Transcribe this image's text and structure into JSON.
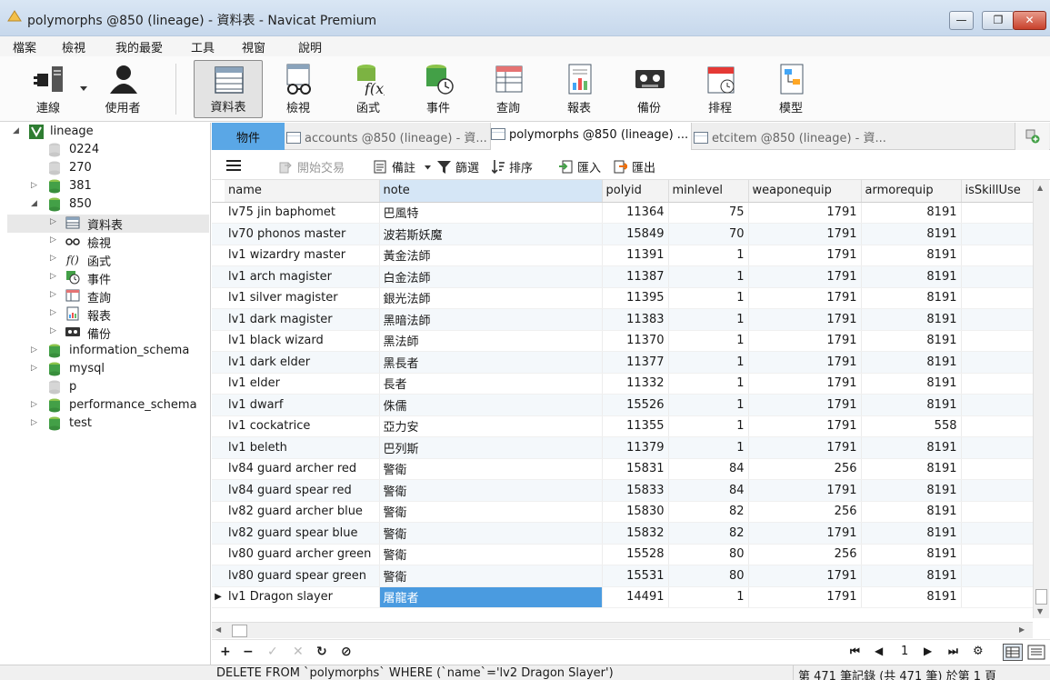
{
  "window": {
    "title": "polymorphs @850 (lineage) - 資料表 - Navicat Premium",
    "min": "—",
    "max": "❐",
    "close": "✕"
  },
  "menu": [
    "檔案",
    "檢視",
    "我的最愛",
    "工具",
    "視窗",
    "說明"
  ],
  "toolbar": {
    "connection": "連線",
    "user": "使用者",
    "table": "資料表",
    "view": "檢視",
    "function": "函式",
    "event": "事件",
    "query": "查詢",
    "report": "報表",
    "backup": "備份",
    "schedule": "排程",
    "model": "模型"
  },
  "tree": {
    "root": "lineage",
    "db_0224": "0224",
    "db_270": "270",
    "db_381": "381",
    "db_850": "850",
    "child_table": "資料表",
    "child_view": "檢視",
    "child_function": "函式",
    "child_event": "事件",
    "child_query": "查詢",
    "child_report": "報表",
    "child_backup": "備份",
    "db_information_schema": "information_schema",
    "db_mysql": "mysql",
    "db_p": "p",
    "db_performance_schema": "performance_schema",
    "db_test": "test"
  },
  "tabs": {
    "objects": "物件",
    "accounts": "accounts @850 (lineage) - 資...",
    "polymorphs": "polymorphs @850 (lineage) ...",
    "etcitem": "etcitem @850 (lineage) - 資..."
  },
  "subtoolbar": {
    "begin_transaction": "開始交易",
    "memo": "備註",
    "filter": "篩選",
    "sort": "排序",
    "import": "匯入",
    "export": "匯出"
  },
  "columns": [
    "name",
    "note",
    "polyid",
    "minlevel",
    "weaponequip",
    "armorequip",
    "isSkillUse"
  ],
  "rows": [
    [
      "lv75 jin baphomet",
      "巴風特",
      "11364",
      "75",
      "1791",
      "8191",
      ""
    ],
    [
      "lv70 phonos master",
      "波若斯妖魔",
      "15849",
      "70",
      "1791",
      "8191",
      ""
    ],
    [
      "lv1 wizardry master",
      "黃金法師",
      "11391",
      "1",
      "1791",
      "8191",
      ""
    ],
    [
      "lv1 arch magister",
      "白金法師",
      "11387",
      "1",
      "1791",
      "8191",
      ""
    ],
    [
      "lv1 silver magister",
      "銀光法師",
      "11395",
      "1",
      "1791",
      "8191",
      ""
    ],
    [
      "lv1 dark magister",
      "黑暗法師",
      "11383",
      "1",
      "1791",
      "8191",
      ""
    ],
    [
      "lv1 black wizard",
      "黑法師",
      "11370",
      "1",
      "1791",
      "8191",
      ""
    ],
    [
      "lv1 dark elder",
      "黑長者",
      "11377",
      "1",
      "1791",
      "8191",
      ""
    ],
    [
      "lv1 elder",
      "長者",
      "11332",
      "1",
      "1791",
      "8191",
      ""
    ],
    [
      "lv1 dwarf",
      "侏儒",
      "15526",
      "1",
      "1791",
      "8191",
      ""
    ],
    [
      "lv1 cockatrice",
      "亞力安",
      "11355",
      "1",
      "1791",
      "558",
      ""
    ],
    [
      "lv1 beleth",
      "巴列斯",
      "11379",
      "1",
      "1791",
      "8191",
      ""
    ],
    [
      "lv84 guard archer red",
      "警衛",
      "15831",
      "84",
      "256",
      "8191",
      ""
    ],
    [
      "lv84 guard spear red",
      "警衛",
      "15833",
      "84",
      "1791",
      "8191",
      ""
    ],
    [
      "lv82 guard archer blue",
      "警衛",
      "15830",
      "82",
      "256",
      "8191",
      ""
    ],
    [
      "lv82 guard spear blue",
      "警衛",
      "15832",
      "82",
      "1791",
      "8191",
      ""
    ],
    [
      "lv80 guard archer green",
      "警衛",
      "15528",
      "80",
      "256",
      "8191",
      ""
    ],
    [
      "lv80 guard spear green",
      "警衛",
      "15531",
      "80",
      "1791",
      "8191",
      ""
    ],
    [
      "lv1 Dragon slayer",
      "屠龍者",
      "14491",
      "1",
      "1791",
      "8191",
      ""
    ]
  ],
  "current_row_index": 18,
  "navbar": {
    "page": "1"
  },
  "status": {
    "sql": "DELETE FROM `polymorphs` WHERE (`name`='lv2 Dragon Slayer')",
    "records": "第 471 筆記錄 (共 471 筆) 於第 1 頁"
  },
  "colors": {
    "accent": "#4a9be0",
    "objects_tab": "#5aa7e6",
    "db_green": "#3a9a3a"
  }
}
